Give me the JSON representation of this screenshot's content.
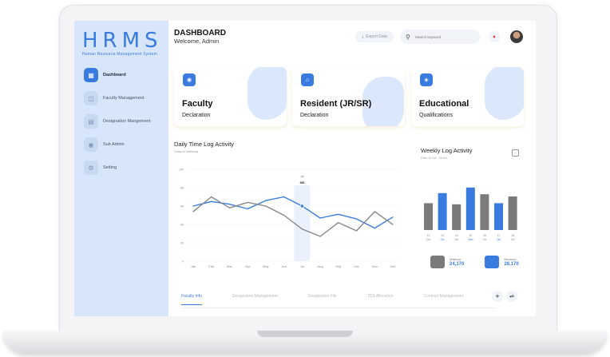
{
  "app": {
    "logo_text": "HRMS",
    "logo_subtitle": "Human Resource Management System"
  },
  "sidebar": {
    "items": [
      {
        "label": "Dashboard",
        "icon": "grid-icon",
        "active": true
      },
      {
        "label": "Faculty Management",
        "icon": "card-icon",
        "active": false
      },
      {
        "label": "Designation Mangement",
        "icon": "list-icon",
        "active": false
      },
      {
        "label": "Sub Admin",
        "icon": "users-icon",
        "active": false
      },
      {
        "label": "Setting",
        "icon": "gear-icon",
        "active": false
      }
    ]
  },
  "header": {
    "title": "DASHBOARD",
    "welcome": "Welcome, Admin",
    "export_label": "Export Data",
    "search_placeholder": "Search keyword"
  },
  "cards": [
    {
      "title": "Faculty",
      "subtitle": "Declaration",
      "icon": "users-icon"
    },
    {
      "title": "Resident (JR/SR)",
      "subtitle": "Declaration",
      "icon": "home-icon"
    },
    {
      "title": "Educational",
      "subtitle": "Qualifications",
      "icon": "graduation-cap-icon"
    }
  ],
  "daily_chart": {
    "title": "Daily Time Log Activity",
    "subtitle": "Today vs Yesterday"
  },
  "weekly_chart": {
    "title": "Weekly Log Activity",
    "subtitle": "From 12 Oct - 18 Oct"
  },
  "chart_data": [
    {
      "type": "line",
      "x": [
        "Jan",
        "Feb",
        "Mar",
        "Apr",
        "May",
        "Jun",
        "Jul",
        "Aug",
        "Sep",
        "Oct",
        "Nov",
        "Dec"
      ],
      "yticks": [
        0,
        20,
        40,
        60,
        80,
        100
      ],
      "ylim": [
        0,
        100
      ],
      "series": [
        {
          "color": "#3a7be0",
          "values": [
            60,
            65,
            62,
            57,
            66,
            70,
            60,
            47,
            51,
            46,
            36,
            48
          ]
        },
        {
          "color": "#888888",
          "values": [
            54,
            70,
            58,
            64,
            60,
            50,
            35,
            27,
            42,
            33,
            54,
            40
          ]
        }
      ],
      "highlight": {
        "category": "Jul",
        "label_top": "Jul",
        "label_value": "356"
      },
      "grid": true
    },
    {
      "type": "bar",
      "title": "Weekly Log Activity",
      "categories": [
        "12",
        "13",
        "14",
        "15",
        "16",
        "17",
        "18"
      ],
      "category_days": [
        "Oct",
        "Oct",
        "Oct",
        "Mon",
        "Oct",
        "Oct",
        "Oct"
      ],
      "values": [
        48,
        66,
        46,
        76,
        64,
        48,
        60
      ],
      "colors": [
        "#7a7a7a",
        "#3a7be0",
        "#7a7a7a",
        "#3a7be0",
        "#7a7a7a",
        "#3a7be0",
        "#7a7a7a"
      ],
      "ylim": [
        0,
        100
      ]
    }
  ],
  "legend": [
    {
      "name": "Minimum",
      "value": "24,170",
      "color": "#7a7a7a"
    },
    {
      "name": "Maximum",
      "value": "28,170",
      "color": "#3a7be0"
    }
  ],
  "tabs": [
    {
      "label": "Faculty Info",
      "active": true
    },
    {
      "label": "Designation Management",
      "active": false
    },
    {
      "label": "Designation File",
      "active": false
    },
    {
      "label": "TDS Allocation",
      "active": false
    },
    {
      "label": "Contract Management",
      "active": false
    }
  ],
  "colors": {
    "accent": "#3a7be0",
    "sidebar_bg": "#d7e6fb",
    "neutral": "#888888"
  }
}
